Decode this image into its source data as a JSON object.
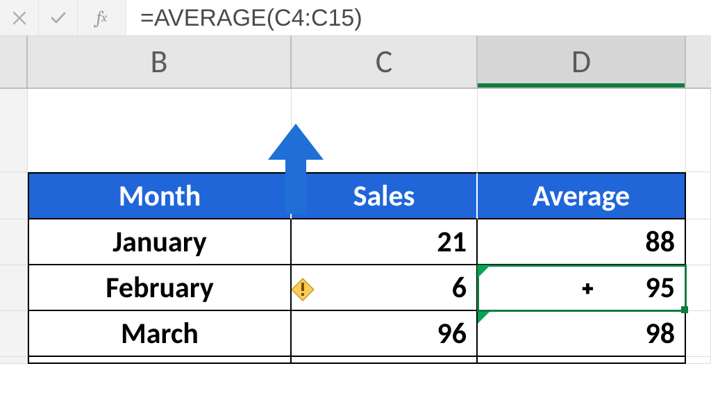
{
  "formula_bar": {
    "formula": "=AVERAGE(C4:C15)"
  },
  "column_headers": {
    "B": "B",
    "C": "C",
    "D": "D"
  },
  "table": {
    "headers": {
      "month": "Month",
      "sales": "Sales",
      "average": "Average"
    },
    "rows": [
      {
        "month": "January",
        "sales": "21",
        "average": "88"
      },
      {
        "month": "February",
        "sales": "6",
        "average": "95",
        "salesCovered": true,
        "hasWarning": true,
        "selected": true,
        "errD": true
      },
      {
        "month": "March",
        "sales": "96",
        "average": "98",
        "errD": true
      }
    ]
  },
  "annotation": {
    "arrow_color": "#1f6fd6"
  }
}
